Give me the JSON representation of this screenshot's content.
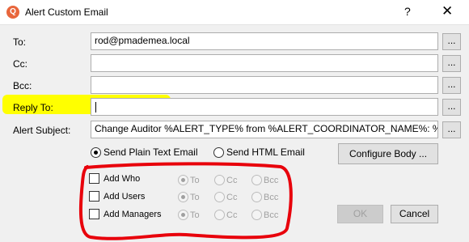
{
  "window": {
    "title": "Alert Custom Email",
    "help": "?",
    "close": "✕",
    "app_icon": "Q"
  },
  "fields": [
    {
      "label": "To:",
      "value": "rod@pmademea.local"
    },
    {
      "label": "Cc:",
      "value": ""
    },
    {
      "label": "Bcc:",
      "value": ""
    },
    {
      "label": "Reply To:",
      "value": ""
    },
    {
      "label": "Alert Subject:",
      "value": "Change Auditor %ALERT_TYPE% from %ALERT_COORDINATOR_NAME%: %ALER"
    }
  ],
  "browse_label": "...",
  "format": {
    "plain": "Send Plain Text Email",
    "html": "Send HTML Email",
    "selected": "plain"
  },
  "configure_body": "Configure Body ...",
  "add_rows": [
    {
      "label": "Add Who",
      "options": [
        "To",
        "Cc",
        "Bcc"
      ]
    },
    {
      "label": "Add Users",
      "options": [
        "To",
        "Cc",
        "Bcc"
      ]
    },
    {
      "label": "Add Managers",
      "options": [
        "To",
        "Cc",
        "Bcc"
      ]
    }
  ],
  "buttons": {
    "ok": "OK",
    "cancel": "Cancel"
  },
  "annotations": {
    "highlight_color": "#ffff00",
    "circle_color": "#e8000b"
  }
}
